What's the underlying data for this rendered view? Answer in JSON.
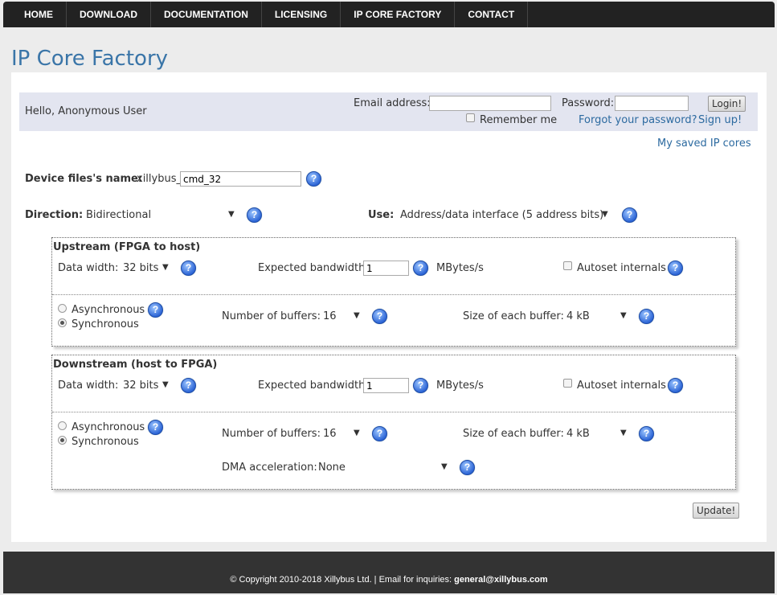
{
  "nav": {
    "items": [
      "HOME",
      "DOWNLOAD",
      "DOCUMENTATION",
      "LICENSING",
      "IP CORE FACTORY",
      "CONTACT"
    ]
  },
  "page_title": "IP Core Factory",
  "login": {
    "hello": "Hello, Anonymous User",
    "email_label": "Email address:",
    "email_value": "",
    "password_label": "Password:",
    "password_value": "",
    "login_button": "Login!",
    "remember_label": "Remember me",
    "remember_checked": false,
    "forgot_link": "Forgot your password?",
    "signup_link": "Sign up!"
  },
  "saved_cores_link": "My saved IP cores",
  "device": {
    "label": "Device files's name:",
    "prefix": "xillybus_",
    "value": "cmd_32"
  },
  "direction": {
    "label": "Direction:",
    "value": "Bidirectional"
  },
  "use": {
    "label": "Use:",
    "value": "Address/data interface (5 address bits)"
  },
  "upstream": {
    "title": "Upstream (FPGA to host)",
    "data_width_label": "Data width:",
    "data_width_value": "32 bits",
    "bandwidth_label": "Expected bandwidth:",
    "bandwidth_value": "1",
    "bandwidth_unit": "MBytes/s",
    "autoset_label": "Autoset internals",
    "autoset_checked": false,
    "async_label": "Asynchronous",
    "sync_label": "Synchronous",
    "mode_selected": "Synchronous",
    "num_buffers_label": "Number of buffers:",
    "num_buffers_value": "16",
    "buffer_size_label": "Size of each buffer:",
    "buffer_size_value": "4 kB"
  },
  "downstream": {
    "title": "Downstream (host to FPGA)",
    "data_width_label": "Data width:",
    "data_width_value": "32 bits",
    "bandwidth_label": "Expected bandwidth:",
    "bandwidth_value": "1",
    "bandwidth_unit": "MBytes/s",
    "autoset_label": "Autoset internals",
    "autoset_checked": false,
    "async_label": "Asynchronous",
    "sync_label": "Synchronous",
    "mode_selected": "Synchronous",
    "num_buffers_label": "Number of buffers:",
    "num_buffers_value": "16",
    "buffer_size_label": "Size of each buffer:",
    "buffer_size_value": "4 kB",
    "dma_label": "DMA acceleration:",
    "dma_value": "None"
  },
  "update_button": "Update!",
  "help_glyph": "?",
  "caret_glyph": "▼",
  "footer": {
    "text": "© Copyright 2010-2018 Xillybus Ltd. | Email for inquiries: ",
    "email": "general@xillybus.com"
  },
  "colors": {
    "title": "#3a75a8",
    "link": "#2c6aa0",
    "nav_bg": "#222222",
    "login_bg": "#e3e5f0",
    "help": "#2d66d6"
  }
}
